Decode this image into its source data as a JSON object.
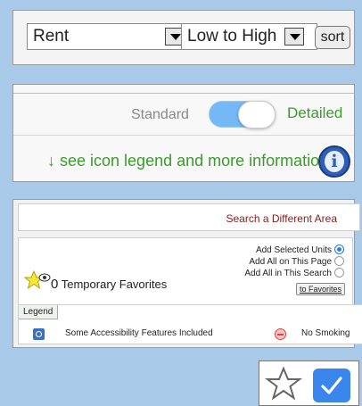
{
  "sort_panel": {
    "sort_field": "Rent",
    "sort_order": "Low to High",
    "sort_button": "sort"
  },
  "view_panel": {
    "standard_label": "Standard",
    "detailed_label": "Detailed",
    "toggle_state": "detailed",
    "legend_link": "↓ see icon legend and more information",
    "info_icon": "info-icon"
  },
  "search_panel": {
    "search_link": "Search a Different Area",
    "favorites_count": "0",
    "favorites_label": "Temporary Favorites",
    "options": [
      {
        "label": "Add Selected Units",
        "selected": true
      },
      {
        "label": "Add All on This Page",
        "selected": false
      },
      {
        "label": "Add All in This Search",
        "selected": false
      }
    ],
    "to_favorites_button": "to Favorites",
    "legend_tab": "Legend",
    "legend_items": [
      {
        "label": "Some Accessibility Features Included",
        "icon": "accessibility-icon"
      },
      {
        "label": "No Smoking",
        "icon": "no-smoking-icon"
      }
    ]
  },
  "icons_panel": {
    "icons": [
      "star-outline-icon",
      "checkbox-checked-icon"
    ]
  },
  "colors": {
    "background": "#a9c9e8",
    "accent_green": "#3d9a2e",
    "toggle_blue": "#75b8f6",
    "link_red": "#8b1a1a",
    "check_blue": "#3a86ec"
  }
}
